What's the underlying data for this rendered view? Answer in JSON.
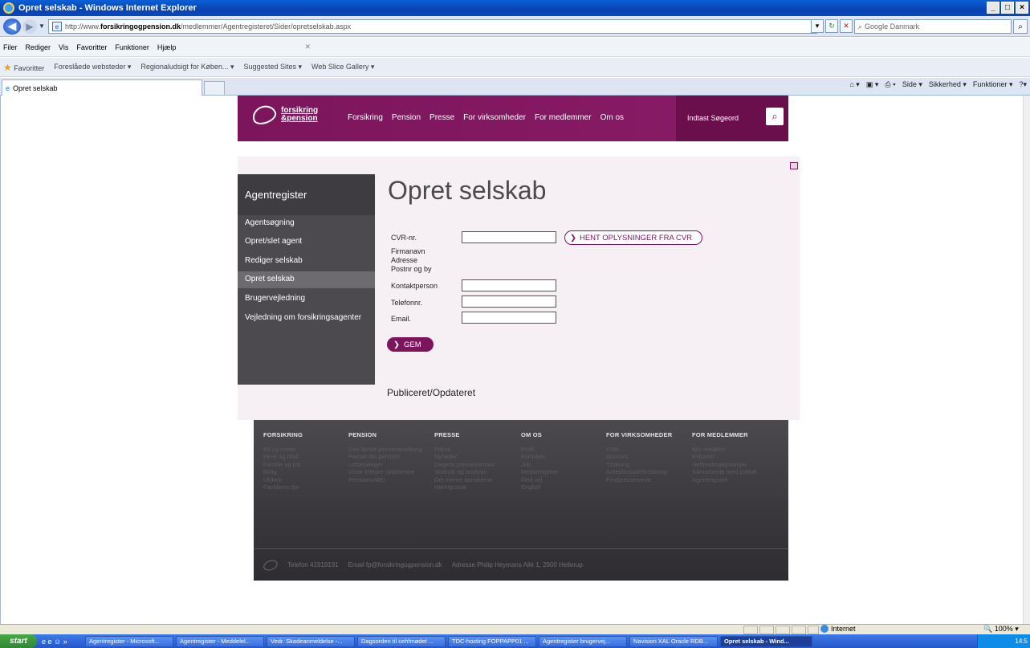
{
  "window": {
    "title": "Opret selskab - Windows Internet Explorer",
    "btn_min": "_",
    "btn_max": "□",
    "btn_close": "×"
  },
  "address": {
    "url_prefix": "http://www.",
    "url_domain": "forsikringogpension.dk",
    "url_path": "/medlemmer/Agentregisteret/Sider/opretselskab.aspx",
    "search_placeholder": "Google Danmark"
  },
  "menu": [
    "Filer",
    "Rediger",
    "Vis",
    "Favoritter",
    "Funktioner",
    "Hjælp"
  ],
  "favorites": {
    "label": "Favoritter",
    "items": [
      "Foreslåede websteder ▾",
      "Regionaludsigt for Køben... ▾",
      "Suggested Sites ▾",
      "Web Slice Gallery ▾"
    ]
  },
  "tab": {
    "label": "Opret selskab"
  },
  "command_bar": [
    "Side ▾",
    "Sikkerhed ▾",
    "Funktioner ▾"
  ],
  "site": {
    "logo_line1": "forsikring",
    "logo_line2": "&pension",
    "nav": [
      "Forsikring",
      "Pension",
      "Presse",
      "For virksomheder",
      "For medlemmer",
      "Om os"
    ],
    "search_placeholder": "Indtast Søgeord"
  },
  "sidenav": {
    "title": "Agentregister",
    "items": [
      "Agentsøgning",
      "Opret/slet agent",
      "Rediger selskab",
      "Opret selskab",
      "Brugervejledning",
      "Vejledning om forsikringsagenter"
    ],
    "active_index": 3
  },
  "page": {
    "title": "Opret selskab",
    "published": "Publiceret/Opdateret"
  },
  "form": {
    "cvr_label": "CVR-nr.",
    "firmanavn_label": "Firmanavn",
    "adresse_label": "Adresse",
    "postnr_label": "Postnr og by",
    "kontakt_label": "Kontaktperson",
    "telefon_label": "Telefonnr.",
    "email_label": "Email.",
    "cvr_button": "HENT OPLYSNINGER FRA CVR",
    "save_button": "GEM"
  },
  "footer": {
    "columns": [
      {
        "heading": "FORSIKRING",
        "links": [
          "Bil og motor",
          "Ferie og fritid",
          "Familie og job",
          "Bolig",
          "Ulykke",
          "Familiens dyr"
        ]
      },
      {
        "heading": "PENSION",
        "links": [
          "Den første pensionsordning",
          "Passer din pension",
          "Udbetalinger",
          "Visse kritiske sygdomme",
          "PensionsABC"
        ]
      },
      {
        "heading": "PRESSE",
        "links": [
          "Fokus",
          "Nyheder",
          "Dagens pressekontakt",
          "Statistik og analyse",
          "Det mener danskerne",
          "Høringssvar"
        ]
      },
      {
        "heading": "OM OS",
        "links": [
          "Profil",
          "Formålet",
          "Job",
          "Medarbejdere",
          "Find vej",
          "English"
        ]
      },
      {
        "heading": "FOR VIRKSOMHEDER",
        "links": [
          "CSR",
          "Ansvars",
          "Tilsikring",
          "Arbejdsskadeforsikring",
          "Findpresseservic"
        ]
      },
      {
        "heading": "FOR MEDLEMMER",
        "links": [
          "Bliv medlem",
          "Extranet",
          "Helbredsoplysninger",
          "Samarbejde med politiet",
          "Agentregister"
        ]
      }
    ],
    "phone": "Telefon 41919191",
    "email": "Email fp@forsikringogpension.dk",
    "address": "Adresse Philip Heymans Allé 1, 2900 Hellerup"
  },
  "status": {
    "zone": "Internet",
    "zoom": "🔍 100% ▾"
  },
  "taskbar": {
    "start": "start",
    "tasks": [
      "Agentregister - Microsoft...",
      "Agentregister - Meddelel...",
      "Vedr. Skadeanmeldelse -...",
      "Dagsorden til cehfmødet ...",
      "TDC-hosting FOPPAPP01 ...",
      "Agentregister brugervej...",
      "Navision XAL Oracle RDB...",
      "Opret selskab - Wind..."
    ],
    "clock": "14:5"
  }
}
